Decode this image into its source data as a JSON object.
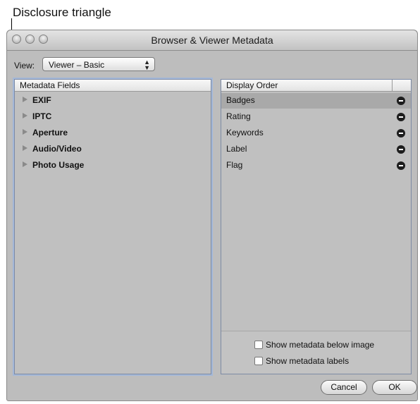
{
  "callout": {
    "label": "Disclosure triangle"
  },
  "window": {
    "title": "Browser & Viewer Metadata"
  },
  "view": {
    "label": "View:",
    "selected": "Viewer – Basic"
  },
  "metadata_fields": {
    "header": "Metadata Fields",
    "items": [
      {
        "label": "EXIF"
      },
      {
        "label": "IPTC"
      },
      {
        "label": "Aperture"
      },
      {
        "label": "Audio/Video"
      },
      {
        "label": "Photo Usage"
      }
    ]
  },
  "display_order": {
    "header": "Display Order",
    "items": [
      {
        "label": "Badges",
        "selected": true
      },
      {
        "label": "Rating"
      },
      {
        "label": "Keywords"
      },
      {
        "label": "Label"
      },
      {
        "label": "Flag"
      }
    ]
  },
  "options": {
    "show_below_image": "Show metadata below image",
    "show_labels": "Show metadata labels"
  },
  "buttons": {
    "cancel": "Cancel",
    "ok": "OK"
  }
}
